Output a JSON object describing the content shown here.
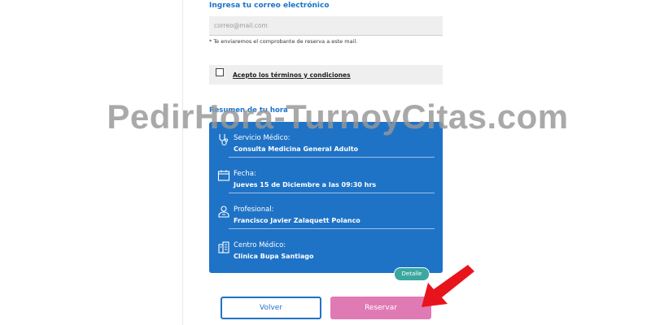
{
  "form": {
    "email_label": "Ingresa tu correo electrónico",
    "email_placeholder": "correo@mail.com",
    "email_note": "* Te enviaremos el comprobante de reserva a este mail.",
    "terms_label": "Acepto los términos y condiciones",
    "terms_checked": false
  },
  "summary": {
    "title": "Resumen de tu hora",
    "rows": [
      {
        "icon": "stethoscope-icon",
        "label": "Servicio Médico:",
        "value": "Consulta Medicina General Adulto"
      },
      {
        "icon": "calendar-icon",
        "label": "Fecha:",
        "value": "Jueves 15 de Diciembre a las 09:30 hrs"
      },
      {
        "icon": "doctor-icon",
        "label": "Profesional:",
        "value": "Francisco Javier Zalaquett Polanco"
      },
      {
        "icon": "building-icon",
        "label": "Centro Médico:",
        "value": "Clinica Bupa Santiago"
      }
    ],
    "detail_badge": "Detalle"
  },
  "actions": {
    "back_label": "Volver",
    "reserve_label": "Reservar"
  },
  "watermark": "PedirHora-TurnoyCitas.com",
  "colors": {
    "primary": "#1f73c6",
    "reserve": "#e07ab5",
    "badge": "#3aa7a0",
    "arrow": "#e8141b"
  }
}
